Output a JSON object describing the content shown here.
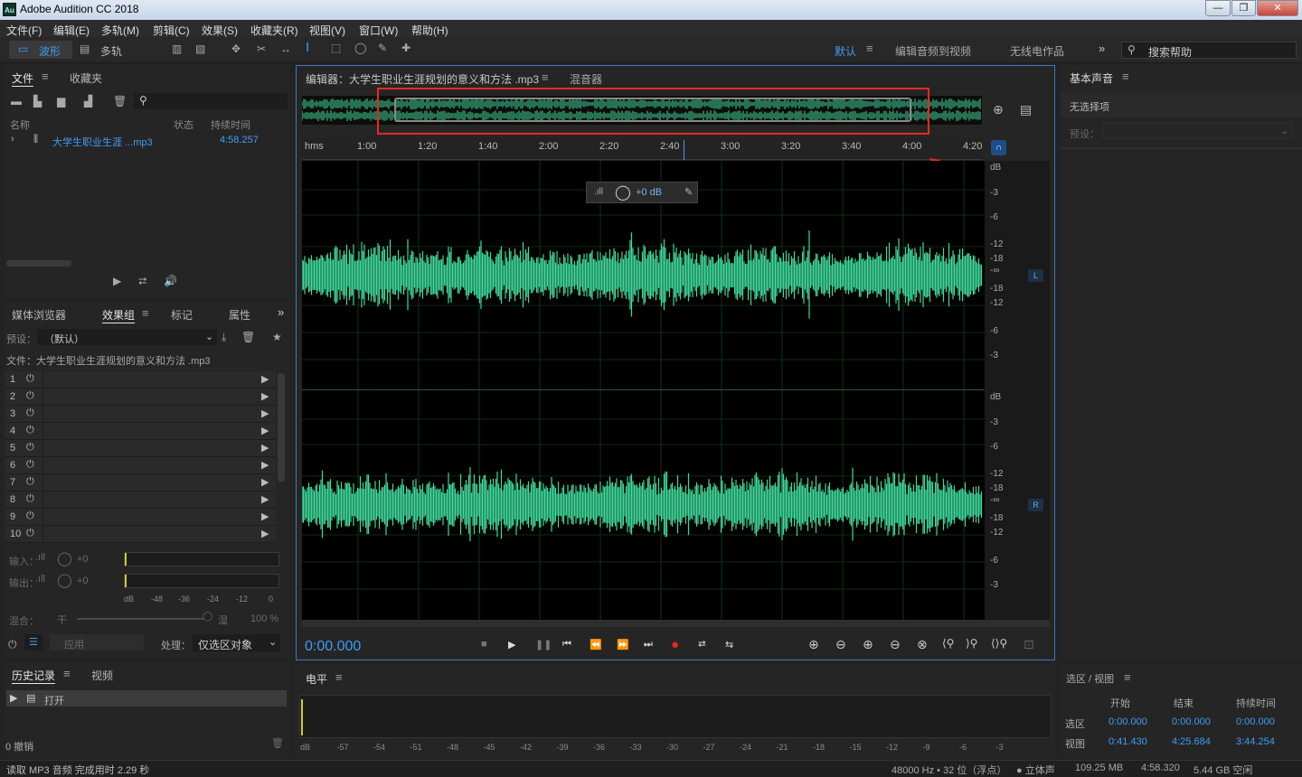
{
  "app": {
    "icon_text": "Au",
    "title": "Adobe Audition CC 2018",
    "win_buttons": [
      "—",
      "❐",
      "✕"
    ]
  },
  "menu": [
    "文件(F)",
    "编辑(E)",
    "多轨(M)",
    "剪辑(C)",
    "效果(S)",
    "收藏夹(R)",
    "视图(V)",
    "窗口(W)",
    "帮助(H)"
  ],
  "toolbar": {
    "waveform": "波形",
    "multitrack": "多轨",
    "workspaces": [
      "默认",
      "编辑音频到视频",
      "无线电作品"
    ],
    "search_placeholder": "搜索帮助"
  },
  "files_panel": {
    "tabs": [
      "文件",
      "收藏夹"
    ],
    "columns": [
      "名称",
      "状态",
      "持续时间"
    ],
    "file": {
      "name": "大学生职业生涯 ...mp3",
      "duration": "4:58.257"
    }
  },
  "effects_panel": {
    "tabs": [
      "媒体浏览器",
      "效果组",
      "标记",
      "属性"
    ],
    "preset_label": "预设：",
    "preset_value": "（默认）",
    "file_label": "文件：大学生职业生涯规划的意义和方法 .mp3",
    "slots": [
      "1",
      "2",
      "3",
      "4",
      "5",
      "6",
      "7",
      "8",
      "9",
      "10"
    ],
    "input_label": "输入：",
    "output_label": "输出：",
    "gain_value": "+0",
    "meter_scale": [
      "dB",
      "-48",
      "-36",
      "-24",
      "-12",
      "0"
    ],
    "mix_label": "混合：",
    "mix_dry": "干",
    "mix_wet": "湿",
    "mix_value": "100 %",
    "apply": "应用",
    "process_label": "处理：",
    "process_value": "仅选区对象"
  },
  "history_panel": {
    "tabs": [
      "历史记录",
      "视频"
    ],
    "item": "打开",
    "undo": "0 撤销"
  },
  "editor": {
    "tab_title": "编辑器：大学生职业生涯规划的意义和方法 .mp3",
    "mixer_tab": "混音器",
    "hud_gain": "+0 dB",
    "current_time": "0:00.000",
    "time_ruler": [
      "hms",
      "1:00",
      "1:20",
      "1:40",
      "2:00",
      "2:20",
      "2:40",
      "3:00",
      "3:20",
      "3:40",
      "4:00",
      "4:20"
    ],
    "db_scale": [
      "dB",
      "-3",
      "-6",
      "-12",
      "-18",
      "-∞",
      "-18",
      "-12",
      "-6",
      "-3"
    ],
    "channels": [
      "L",
      "R"
    ]
  },
  "levels_panel": {
    "title": "电平",
    "scale": [
      "dB",
      "-57",
      "-54",
      "-51",
      "-48",
      "-45",
      "-42",
      "-39",
      "-36",
      "-33",
      "-30",
      "-27",
      "-24",
      "-21",
      "-18",
      "-15",
      "-12",
      "-9",
      "-6",
      "-3"
    ]
  },
  "essential_sound": {
    "title": "基本声音",
    "no_selection": "无选择项",
    "preset_label": "预设："
  },
  "selection_view": {
    "title": "选区 / 视图",
    "columns": [
      "开始",
      "结束",
      "持续时间"
    ],
    "rows": [
      {
        "label": "选区",
        "start": "0:00.000",
        "end": "0:00.000",
        "duration": "0:00.000"
      },
      {
        "label": "视图",
        "start": "0:41.430",
        "end": "4:25.684",
        "duration": "3:44.254"
      }
    ]
  },
  "status": {
    "left": "读取 MP3 音频 完成用时 2.29 秒",
    "right": [
      "48000 Hz • 32 位（浮点）",
      "● 立体声",
      "109.25 MB",
      "4:58.320",
      "5.44 GB 空闲"
    ]
  },
  "colors": {
    "waveform": "#3fd99c",
    "accent": "#3f9cf5",
    "highlight": "#e52a22"
  }
}
